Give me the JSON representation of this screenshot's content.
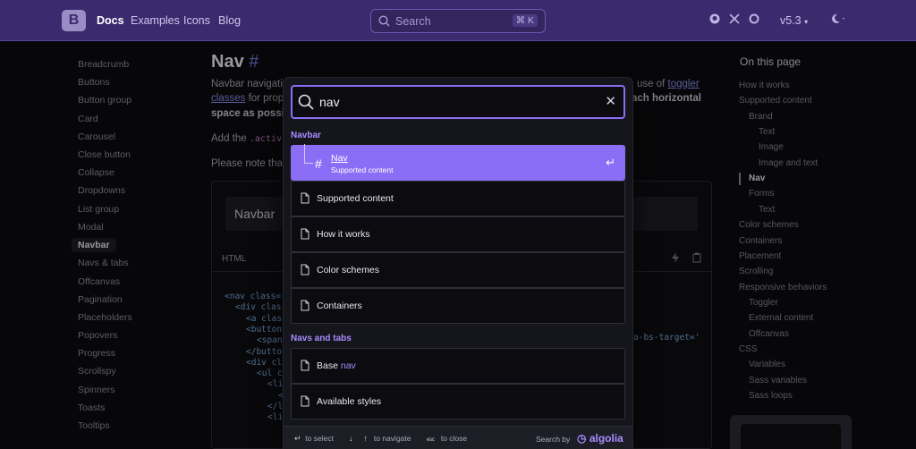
{
  "navbar": {
    "brand": "B",
    "links": [
      "Docs",
      "Examples",
      "Icons",
      "Blog"
    ],
    "search_placeholder": "Search",
    "search_shortcut": "⌘ K",
    "version": "v5.3"
  },
  "sidebar": {
    "items": [
      "Breadcrumb",
      "Buttons",
      "Button group",
      "Card",
      "Carousel",
      "Close button",
      "Collapse",
      "Dropdowns",
      "List group",
      "Modal",
      "Navbar",
      "Navs & tabs",
      "Offcanvas",
      "Pagination",
      "Placeholders",
      "Popovers",
      "Progress",
      "Scrollspy",
      "Spinners",
      "Toasts",
      "Tooltips"
    ],
    "active_index": 10
  },
  "main": {
    "title": "Nav",
    "title_hash": "#",
    "intro_start": "Navbar navigati",
    "intro_link": "toggler",
    "intro_prefix": "use of",
    "line2_link": "classes",
    "line2_text": "for prop",
    "line2_bold": "ach horizontal",
    "line3_bold": "space as possi",
    "line4_text": "Add the",
    "line4_code": ".activ",
    "line5_text": "Please note that",
    "example_navbar": "Navbar",
    "code_lang": "HTML",
    "code_lines": [
      "<nav class=",
      "<div clas",
      "<a clas",
      "<button",
      "<span",
      "</butto",
      "<div cl",
      "<ul c",
      "<li",
      "<",
      "</l",
      "<li"
    ],
    "code_right": "a-bs-target='"
  },
  "toc": {
    "title": "On this page",
    "items": [
      "How it works",
      "Supported content",
      "Brand",
      "Text",
      "Image",
      "Image and text",
      "Nav",
      "Forms",
      "Text",
      "Color schemes",
      "Containers",
      "Placement",
      "Scrolling",
      "Responsive behaviors",
      "Toggler",
      "External content",
      "Offcanvas",
      "CSS",
      "Variables",
      "Sass variables",
      "Sass loops"
    ]
  },
  "search_modal": {
    "query": "nav",
    "groups": [
      {
        "title": "Navbar",
        "hits": [
          {
            "title": "Nav",
            "subtitle": "Supported content",
            "selected": true
          },
          {
            "title": "Supported content"
          },
          {
            "title": "How it works"
          },
          {
            "title": "Color schemes"
          },
          {
            "title": "Containers"
          }
        ]
      },
      {
        "title": "Navs and tabs",
        "hits": [
          {
            "title_prefix": "Base ",
            "title_highlight": "nav"
          },
          {
            "title": "Available styles"
          }
        ]
      }
    ],
    "footer": {
      "select_key": "↵",
      "select_label": "to select",
      "nav_key_down": "↓",
      "nav_key_up": "↑",
      "nav_label": "to navigate",
      "close_key": "esc",
      "close_label": "to close",
      "search_by": "Search by",
      "algolia": "algolia"
    }
  },
  "colors": {
    "navbar_bg": "#3b2a6e",
    "accent": "#8c6df5",
    "highlight": "#a88cff",
    "page_bg": "#0b0b0f"
  }
}
